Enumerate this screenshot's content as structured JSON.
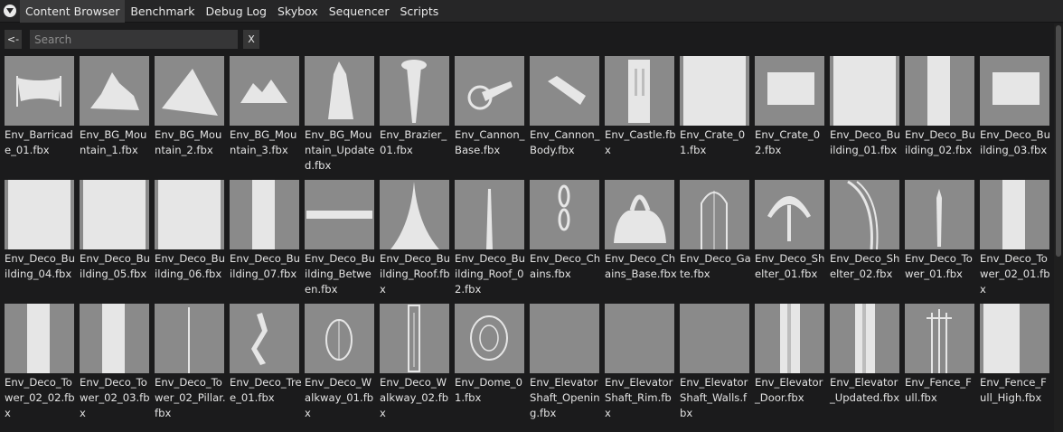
{
  "tabs": [
    {
      "label": "Content Browser",
      "active": true
    },
    {
      "label": "Benchmark",
      "active": false
    },
    {
      "label": "Debug Log",
      "active": false
    },
    {
      "label": "Skybox",
      "active": false
    },
    {
      "label": "Sequencer",
      "active": false
    },
    {
      "label": "Scripts",
      "active": false
    }
  ],
  "toolbar": {
    "back_label": "<-",
    "search_placeholder": "Search",
    "search_value": "",
    "clear_label": "X"
  },
  "assets": [
    {
      "name": "Env_Barricade_01.fbx",
      "icon": "barricade"
    },
    {
      "name": "Env_BG_Mountain_1.fbx",
      "icon": "rock"
    },
    {
      "name": "Env_BG_Mountain_2.fbx",
      "icon": "peak"
    },
    {
      "name": "Env_BG_Mountain_3.fbx",
      "icon": "rock-small"
    },
    {
      "name": "Env_BG_Mountain_Updated.fbx",
      "icon": "spire"
    },
    {
      "name": "Env_Brazier_01.fbx",
      "icon": "brazier"
    },
    {
      "name": "Env_Cannon_Base.fbx",
      "icon": "cannon"
    },
    {
      "name": "Env_Cannon_Body.fbx",
      "icon": "cannon-body"
    },
    {
      "name": "Env_Castle.fbx",
      "icon": "castle"
    },
    {
      "name": "Env_Crate_01.fbx",
      "icon": "panel-full"
    },
    {
      "name": "Env_Crate_02.fbx",
      "icon": "crate"
    },
    {
      "name": "Env_Deco_Building_01.fbx",
      "icon": "panel-full"
    },
    {
      "name": "Env_Deco_Building_02.fbx",
      "icon": "strip"
    },
    {
      "name": "Env_Deco_Building_03.fbx",
      "icon": "crate"
    },
    {
      "name": "Env_Deco_Building_04.fbx",
      "icon": "panel-full"
    },
    {
      "name": "Env_Deco_Building_05.fbx",
      "icon": "panel-full"
    },
    {
      "name": "Env_Deco_Building_06.fbx",
      "icon": "panel-full"
    },
    {
      "name": "Env_Deco_Building_07.fbx",
      "icon": "strip"
    },
    {
      "name": "Env_Deco_Building_Between.fbx",
      "icon": "beam"
    },
    {
      "name": "Env_Deco_Building_Roof.fbx",
      "icon": "roof"
    },
    {
      "name": "Env_Deco_Building_Roof_02.fbx",
      "icon": "needle"
    },
    {
      "name": "Env_Deco_Chains.fbx",
      "icon": "chains"
    },
    {
      "name": "Env_Deco_Chains_Base.fbx",
      "icon": "bell"
    },
    {
      "name": "Env_Deco_Gate.fbx",
      "icon": "gate"
    },
    {
      "name": "Env_Deco_Shelter_01.fbx",
      "icon": "shelter"
    },
    {
      "name": "Env_Deco_Shelter_02.fbx",
      "icon": "shelter2"
    },
    {
      "name": "Env_Deco_Tower_01.fbx",
      "icon": "tower"
    },
    {
      "name": "Env_Deco_Tower_02_01.fbx",
      "icon": "strip"
    },
    {
      "name": "Env_Deco_Tower_02_02.fbx",
      "icon": "strip"
    },
    {
      "name": "Env_Deco_Tower_02_03.fbx",
      "icon": "strip"
    },
    {
      "name": "Env_Deco_Tower_02_Pillar.fbx",
      "icon": "pillar"
    },
    {
      "name": "Env_Deco_Tree_01.fbx",
      "icon": "tree"
    },
    {
      "name": "Env_Deco_Walkway_01.fbx",
      "icon": "walkway"
    },
    {
      "name": "Env_Deco_Walkway_02.fbx",
      "icon": "walkway2"
    },
    {
      "name": "Env_Dome_01.fbx",
      "icon": "dome"
    },
    {
      "name": "Env_ElevatorShaft_Opening.fbx",
      "icon": "empty"
    },
    {
      "name": "Env_ElevatorShaft_Rim.fbx",
      "icon": "empty"
    },
    {
      "name": "Env_ElevatorShaft_Walls.fbx",
      "icon": "empty"
    },
    {
      "name": "Env_Elevator_Door.fbx",
      "icon": "door"
    },
    {
      "name": "Env_Elevator_Updated.fbx",
      "icon": "door"
    },
    {
      "name": "Env_Fence_Full.fbx",
      "icon": "fence"
    },
    {
      "name": "Env_Fence_Full_High.fbx",
      "icon": "fence-high"
    }
  ]
}
